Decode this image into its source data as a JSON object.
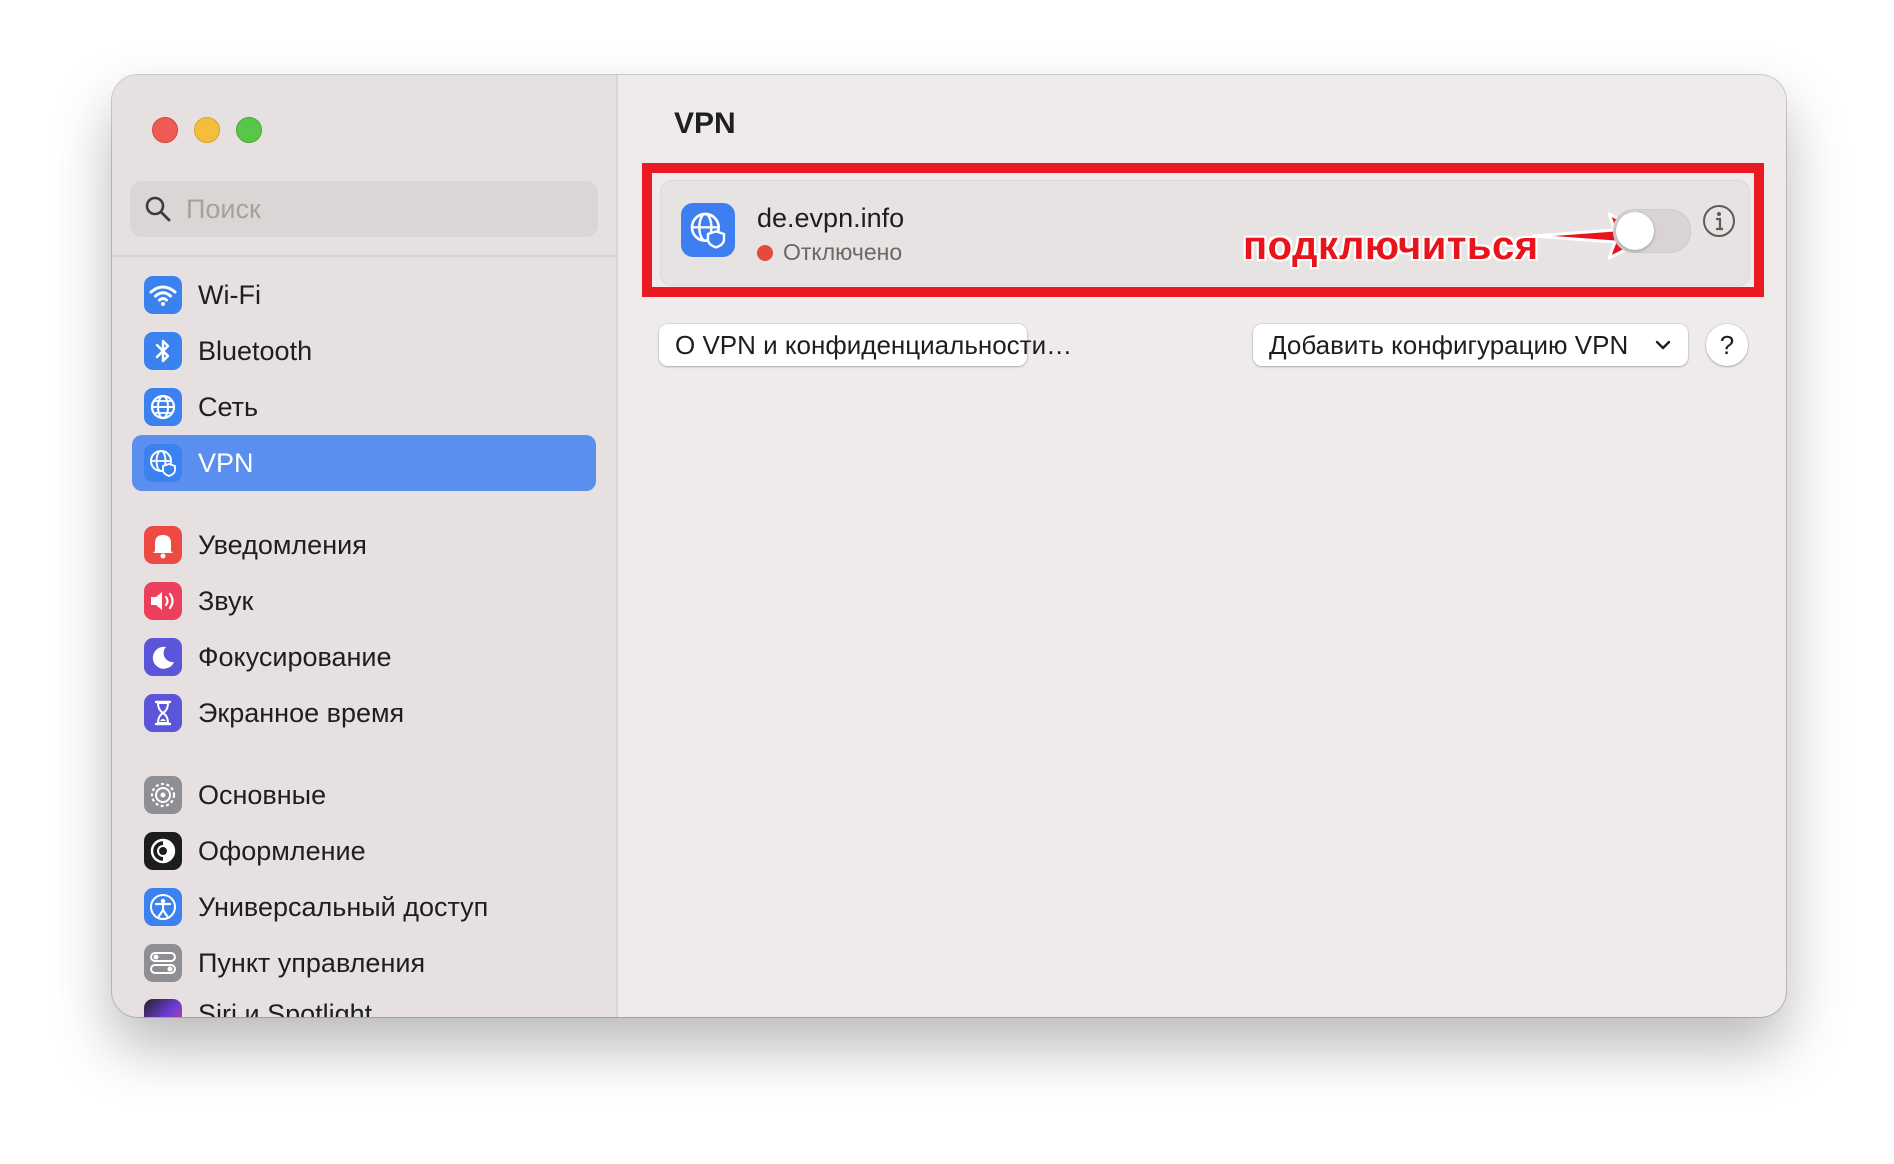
{
  "search": {
    "placeholder": "Поиск"
  },
  "sidebar": {
    "items": [
      {
        "label": "Wi-Fi",
        "icon": "wifi-icon",
        "color": "#3b82f0"
      },
      {
        "label": "Bluetooth",
        "icon": "bluetooth-icon",
        "color": "#3b82f0"
      },
      {
        "label": "Сеть",
        "icon": "globe-icon",
        "color": "#3b82f0"
      },
      {
        "label": "VPN",
        "icon": "vpn-globe-icon",
        "color": "#3b82f0",
        "selected": true
      },
      {
        "label": "Уведомления",
        "icon": "bell-icon",
        "color": "#ec4a43"
      },
      {
        "label": "Звук",
        "icon": "speaker-icon",
        "color": "#ec3f5d"
      },
      {
        "label": "Фокусирование",
        "icon": "moon-icon",
        "color": "#5b55d9"
      },
      {
        "label": "Экранное время",
        "icon": "hourglass-icon",
        "color": "#5b55d9"
      },
      {
        "label": "Основные",
        "icon": "gear-icon",
        "color": "#8e8e93"
      },
      {
        "label": "Оформление",
        "icon": "appearance-icon",
        "color": "#1c1c1e"
      },
      {
        "label": "Универсальный доступ",
        "icon": "accessibility-icon",
        "color": "#3b82f0"
      },
      {
        "label": "Пункт управления",
        "icon": "control-center-icon",
        "color": "#8e8e93"
      },
      {
        "label": "Siri и Spotlight",
        "icon": "siri-icon",
        "color": "#6c3bd6"
      }
    ]
  },
  "main": {
    "title": "VPN",
    "vpn": {
      "name": "de.evpn.info",
      "status": "Отключено",
      "status_color": "#e24b3e",
      "enabled": false
    },
    "annotation": "подключиться",
    "about_button": "О VPN и конфиденциальности…",
    "add_button": "Добавить конфигурацию VPN",
    "help_label": "?"
  },
  "colors": {
    "accent": "#5a8ff0",
    "annotation_red": "#ea1a22"
  }
}
